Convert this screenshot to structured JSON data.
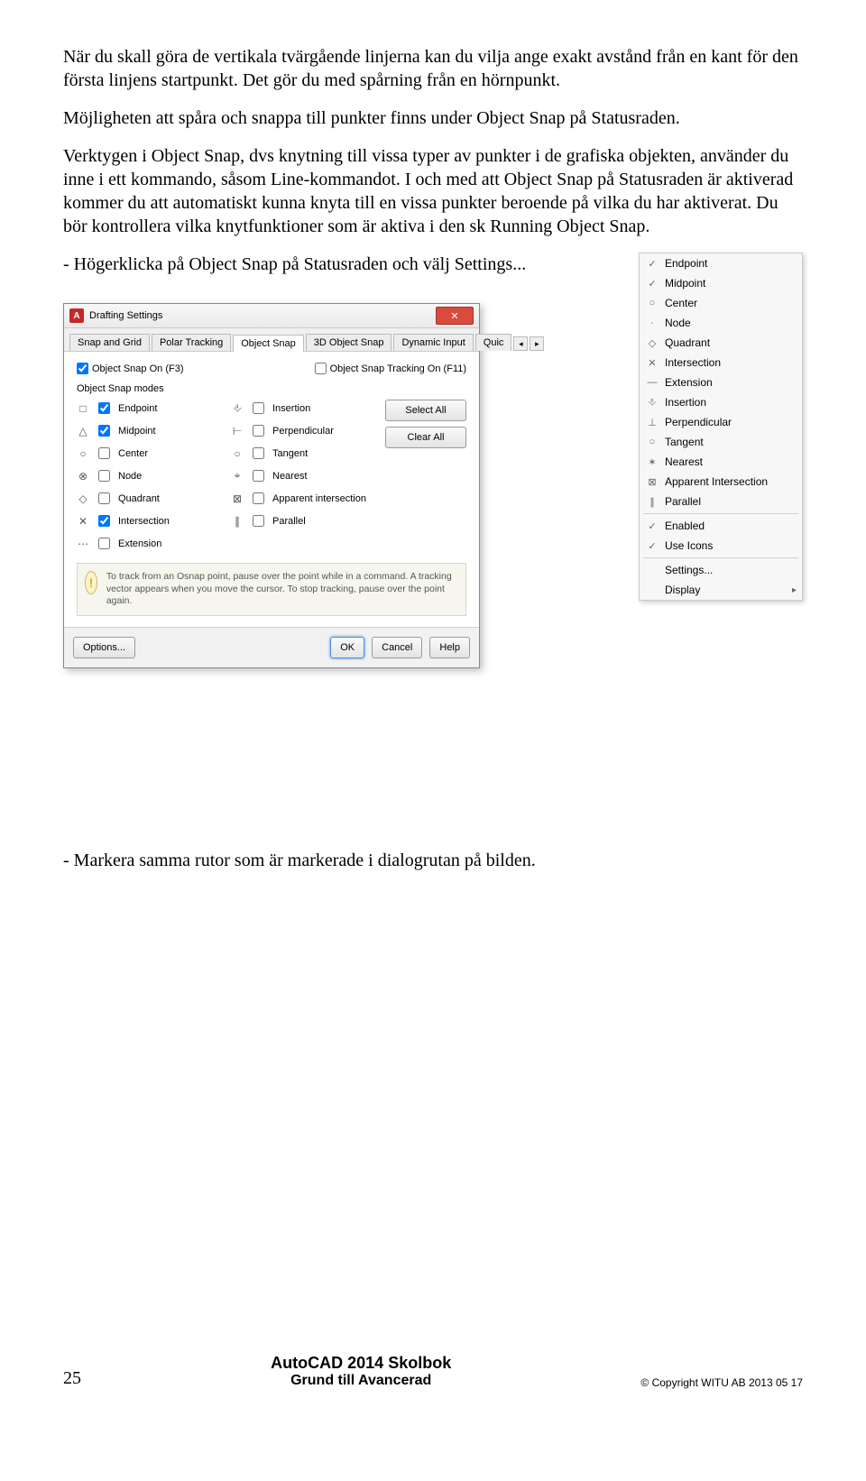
{
  "paragraphs": {
    "p1": "När du skall göra de vertikala tvärgående linjerna kan du vilja ange exakt avstånd från en kant för den första linjens startpunkt. Det gör du med spårning från en hörnpunkt.",
    "p2": "Möjligheten att spåra och snappa till punkter finns under Object Snap på Statusraden.",
    "p3": "Verktygen i Object Snap, dvs knytning till vissa typer av punkter i de grafiska objekten, använder du inne i ett kommando, såsom Line-kommandot. I och med att Object Snap på Statusraden är aktiverad kommer du att automatiskt kunna knyta till en vissa punkter beroende på vilka du har aktiverat. Du bör kontrollera vilka knytfunktioner som är aktiva i den sk Running Object Snap.",
    "p4": "-  Högerklicka på Object Snap på Statusraden och välj Settings...",
    "p5": "-  Markera samma rutor som är markerade i dialogrutan på bilden."
  },
  "context_menu": {
    "items": [
      {
        "icon": "✓",
        "label": "Endpoint"
      },
      {
        "icon": "✓",
        "label": "Midpoint"
      },
      {
        "icon": "○",
        "label": "Center"
      },
      {
        "icon": "·",
        "label": "Node"
      },
      {
        "icon": "◇",
        "label": "Quadrant"
      },
      {
        "icon": "✕",
        "label": "Intersection"
      },
      {
        "icon": "—",
        "label": "Extension"
      },
      {
        "icon": "⎀",
        "label": "Insertion"
      },
      {
        "icon": "⊥",
        "label": "Perpendicular"
      },
      {
        "icon": "○",
        "label": "Tangent"
      },
      {
        "icon": "✶",
        "label": "Nearest"
      },
      {
        "icon": "⊠",
        "label": "Apparent Intersection"
      },
      {
        "icon": "∥",
        "label": "Parallel"
      }
    ],
    "enabled": "Enabled",
    "use_icons": "Use Icons",
    "settings": "Settings...",
    "display": "Display"
  },
  "dialog": {
    "title": "Drafting Settings",
    "tabs": [
      "Snap and Grid",
      "Polar Tracking",
      "Object Snap",
      "3D Object Snap",
      "Dynamic Input",
      "Quic"
    ],
    "active_tab": 2,
    "osnap_on": "Object Snap On (F3)",
    "osnap_track": "Object Snap Tracking On (F11)",
    "group": "Object Snap modes",
    "left": [
      {
        "sym": "□",
        "label": "Endpoint",
        "chk": true
      },
      {
        "sym": "△",
        "label": "Midpoint",
        "chk": true
      },
      {
        "sym": "○",
        "label": "Center",
        "chk": false
      },
      {
        "sym": "⊗",
        "label": "Node",
        "chk": false
      },
      {
        "sym": "◇",
        "label": "Quadrant",
        "chk": false
      },
      {
        "sym": "✕",
        "label": "Intersection",
        "chk": true
      },
      {
        "sym": "⋯",
        "label": "Extension",
        "chk": false
      }
    ],
    "right": [
      {
        "sym": "⎀",
        "label": "Insertion",
        "chk": false
      },
      {
        "sym": "⊢",
        "label": "Perpendicular",
        "chk": false
      },
      {
        "sym": "○",
        "label": "Tangent",
        "chk": false
      },
      {
        "sym": "⌖",
        "label": "Nearest",
        "chk": false
      },
      {
        "sym": "⊠",
        "label": "Apparent intersection",
        "chk": false
      },
      {
        "sym": "∥",
        "label": "Parallel",
        "chk": false
      }
    ],
    "select_all": "Select All",
    "clear_all": "Clear All",
    "tip": "To track from an Osnap point, pause over the point while in a command. A tracking vector appears when you move the cursor. To stop tracking, pause over the point again.",
    "options": "Options...",
    "ok": "OK",
    "cancel": "Cancel",
    "help": "Help"
  },
  "footer": {
    "page": "25",
    "title": "AutoCAD 2014 Skolbok",
    "subtitle": "Grund till Avancerad",
    "copyright": "Copyright WITU AB 2013 05 17"
  }
}
